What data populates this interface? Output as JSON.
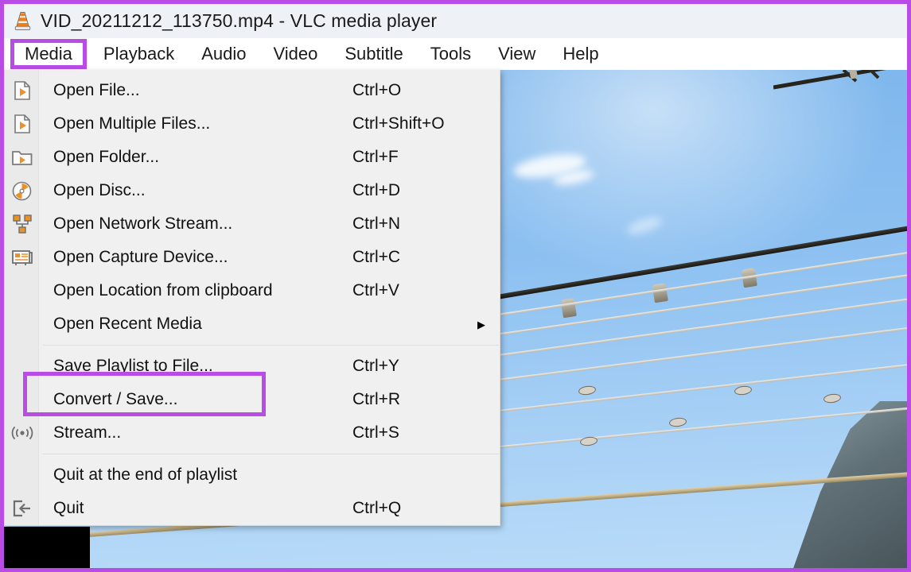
{
  "window": {
    "app_icon": "vlc-cone-icon",
    "title": "VID_20211212_113750.mp4 - VLC media player"
  },
  "menubar": {
    "items": [
      {
        "label": "Media",
        "highlighted": true
      },
      {
        "label": "Playback",
        "highlighted": false
      },
      {
        "label": "Audio",
        "highlighted": false
      },
      {
        "label": "Video",
        "highlighted": false
      },
      {
        "label": "Subtitle",
        "highlighted": false
      },
      {
        "label": "Tools",
        "highlighted": false
      },
      {
        "label": "View",
        "highlighted": false
      },
      {
        "label": "Help",
        "highlighted": false
      }
    ]
  },
  "media_menu": {
    "items": [
      {
        "icon": "file-play-icon",
        "label": "Open File...",
        "shortcut": "Ctrl+O"
      },
      {
        "icon": "file-play-icon",
        "label": "Open Multiple Files...",
        "shortcut": "Ctrl+Shift+O"
      },
      {
        "icon": "folder-play-icon",
        "label": "Open Folder...",
        "shortcut": "Ctrl+F"
      },
      {
        "icon": "disc-icon",
        "label": "Open Disc...",
        "shortcut": "Ctrl+D"
      },
      {
        "icon": "network-icon",
        "label": "Open Network Stream...",
        "shortcut": "Ctrl+N"
      },
      {
        "icon": "capture-device-icon",
        "label": "Open Capture Device...",
        "shortcut": "Ctrl+C"
      },
      {
        "icon": "none",
        "label": "Open Location from clipboard",
        "shortcut": "Ctrl+V"
      },
      {
        "icon": "none",
        "label": "Open Recent Media",
        "shortcut": "",
        "submenu": "▶"
      },
      {
        "icon": "none",
        "label": "Save Playlist to File...",
        "shortcut": "Ctrl+Y"
      },
      {
        "icon": "none",
        "label": "Convert / Save...",
        "shortcut": "Ctrl+R",
        "highlighted": true
      },
      {
        "icon": "stream-icon",
        "label": "Stream...",
        "shortcut": "Ctrl+S"
      },
      {
        "icon": "none",
        "label": "Quit at the end of playlist",
        "shortcut": ""
      },
      {
        "icon": "quit-icon",
        "label": "Quit",
        "shortcut": "Ctrl+Q"
      }
    ]
  },
  "annotation": {
    "color": "#b94ce4",
    "targets": [
      "Media",
      "Convert / Save..."
    ]
  },
  "colors": {
    "accent_purple": "#b94ce4",
    "titlebar_bg": "#eef2f6",
    "menu_bg": "#f0f0f0",
    "icon_orange": "#eb9126",
    "sky_blue": "#8cc0f1"
  }
}
